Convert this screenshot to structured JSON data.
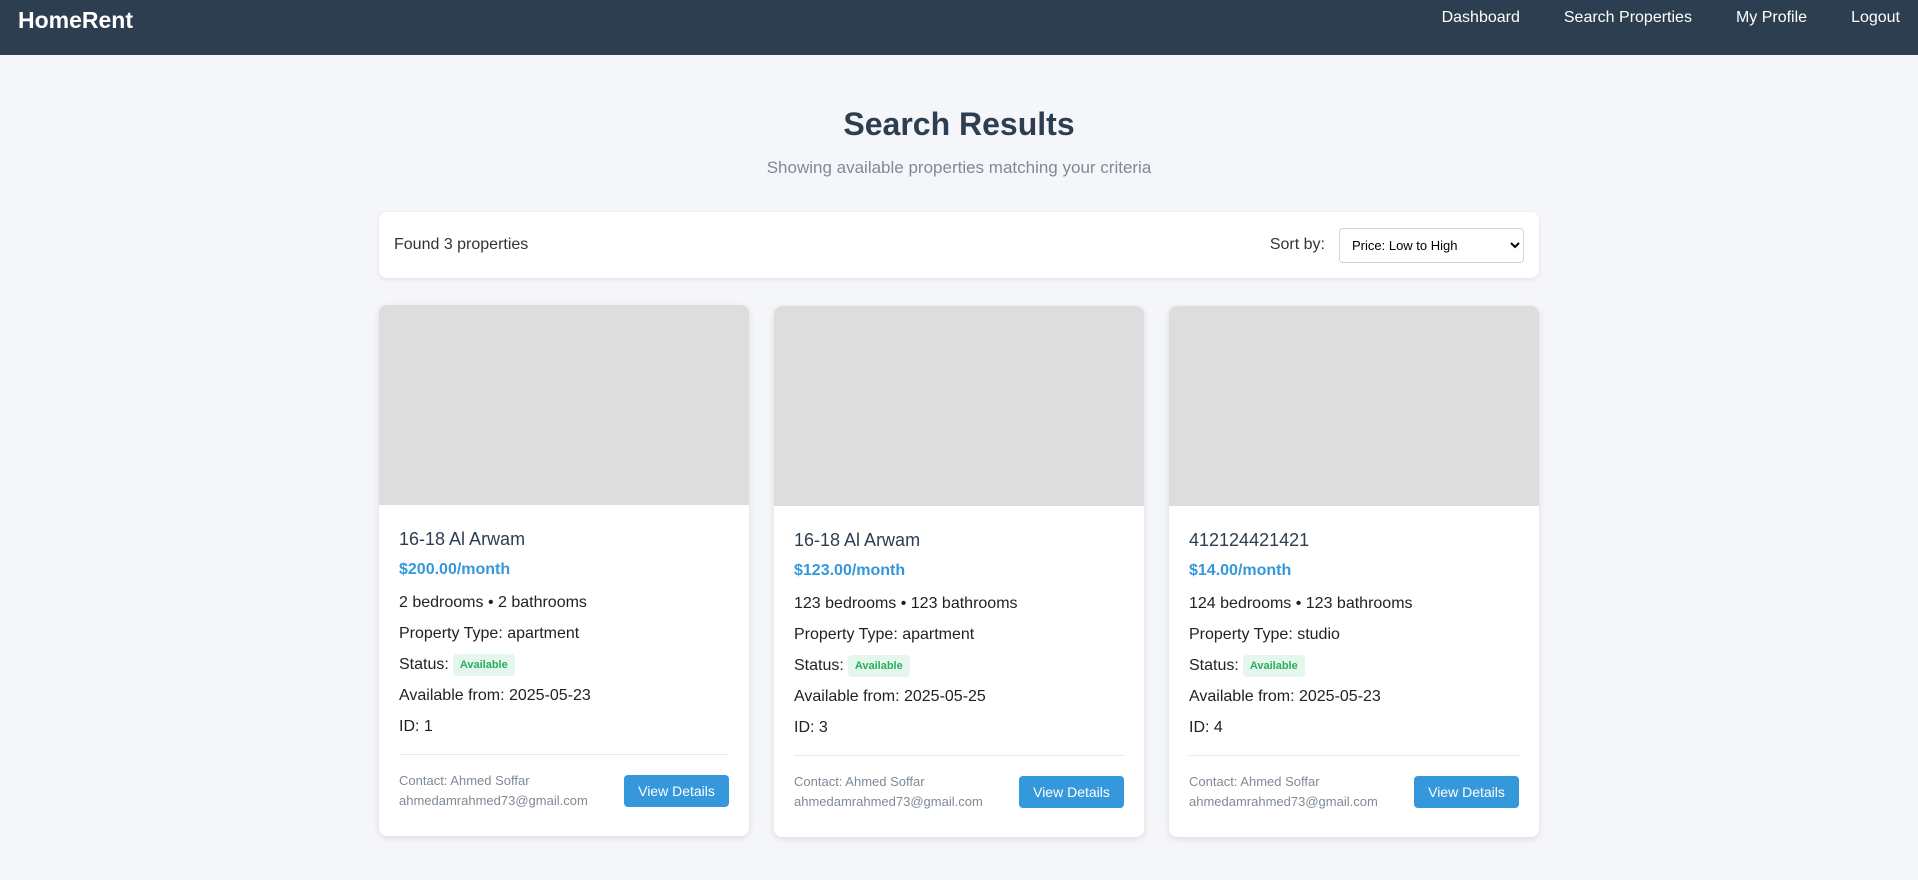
{
  "nav": {
    "brand": "HomeRent",
    "links": [
      "Dashboard",
      "Search Properties",
      "My Profile",
      "Logout"
    ]
  },
  "header": {
    "title": "Search Results",
    "subtitle": "Showing available properties matching your criteria"
  },
  "results_bar": {
    "found_text": "Found 3 properties",
    "sort_label": "Sort by:",
    "sort_selected": "Price: Low to High"
  },
  "properties": [
    {
      "title": "16-18 Al Arwam",
      "price": "$200.00/month",
      "rooms": "2 bedrooms • 2 bathrooms",
      "type": "Property Type: apartment",
      "status_label": "Status:",
      "status": "Available",
      "available_from": "Available from: 2025-05-23",
      "id": "ID: 1",
      "contact_name": "Contact: Ahmed Soffar",
      "contact_email": "ahmedamrahmed73@gmail.com",
      "button": "View Details"
    },
    {
      "title": "16-18 Al Arwam",
      "price": "$123.00/month",
      "rooms": "123 bedrooms • 123 bathrooms",
      "type": "Property Type: apartment",
      "status_label": "Status:",
      "status": "Available",
      "available_from": "Available from: 2025-05-25",
      "id": "ID: 3",
      "contact_name": "Contact: Ahmed Soffar",
      "contact_email": "ahmedamrahmed73@gmail.com",
      "button": "View Details"
    },
    {
      "title": "412124421421",
      "price": "$14.00/month",
      "rooms": "124 bedrooms • 123 bathrooms",
      "type": "Property Type: studio",
      "status_label": "Status:",
      "status": "Available",
      "available_from": "Available from: 2025-05-23",
      "id": "ID: 4",
      "contact_name": "Contact: Ahmed Soffar",
      "contact_email": "ahmedamrahmed73@gmail.com",
      "button": "View Details"
    }
  ],
  "colors": {
    "navbar": "#2c3e50",
    "accent": "#3498db",
    "status_green": "#27ae60",
    "page_bg": "#f5f6f9"
  }
}
